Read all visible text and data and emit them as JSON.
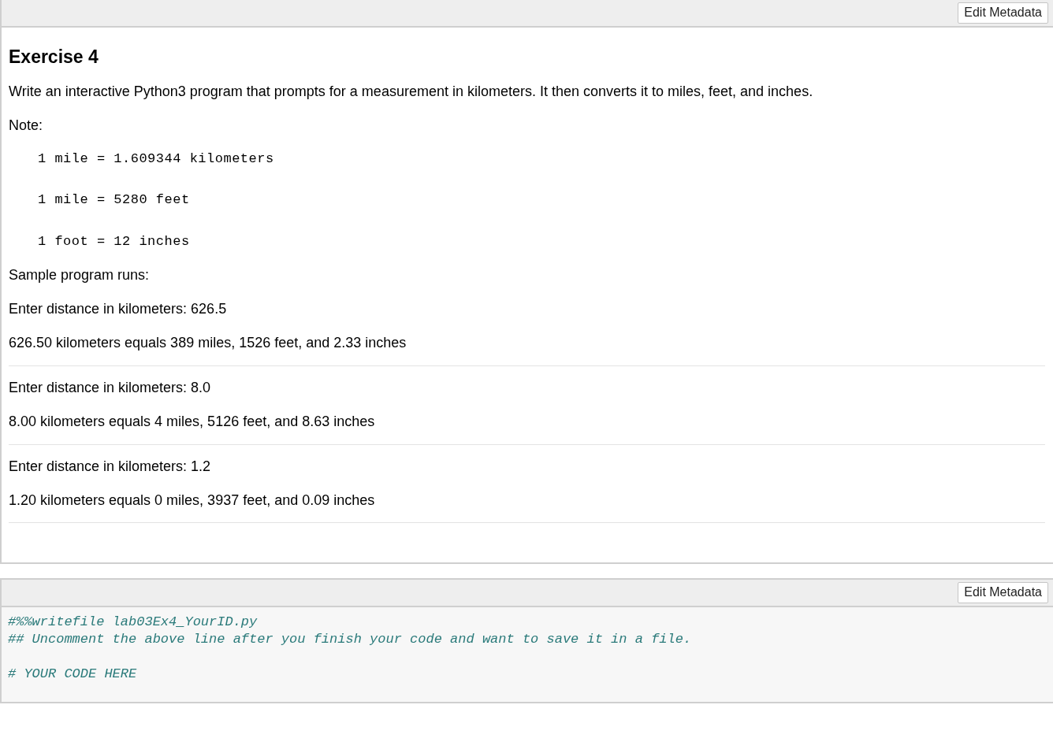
{
  "markdown_cell": {
    "toolbar_button": "Edit Metadata",
    "title": "Exercise 4",
    "description": "Write an interactive Python3 program that prompts for a measurement in kilometers. It then converts it to miles, feet, and inches.",
    "note_label": "Note:",
    "conversions": [
      "1 mile = 1.609344 kilometers",
      "1 mile = 5280 feet",
      "1 foot = 12 inches"
    ],
    "sample_label": "Sample program runs:",
    "runs": [
      {
        "prompt": "Enter distance in kilometers: 626.5",
        "output": "626.50 kilometers equals 389 miles, 1526 feet, and 2.33 inches"
      },
      {
        "prompt": "Enter distance in kilometers: 8.0",
        "output": "8.00 kilometers equals 4 miles, 5126 feet, and 8.63 inches"
      },
      {
        "prompt": "Enter distance in kilometers: 1.2",
        "output": "1.20 kilometers equals 0 miles, 3937 feet, and 0.09 inches"
      }
    ]
  },
  "code_cell": {
    "toolbar_button": "Edit Metadata",
    "code_blocks": [
      [
        "#%%writefile lab03Ex4_YourID.py",
        "## Uncomment the above line after you finish your code and want to save it in a file."
      ],
      [
        "# YOUR CODE HERE"
      ]
    ]
  }
}
